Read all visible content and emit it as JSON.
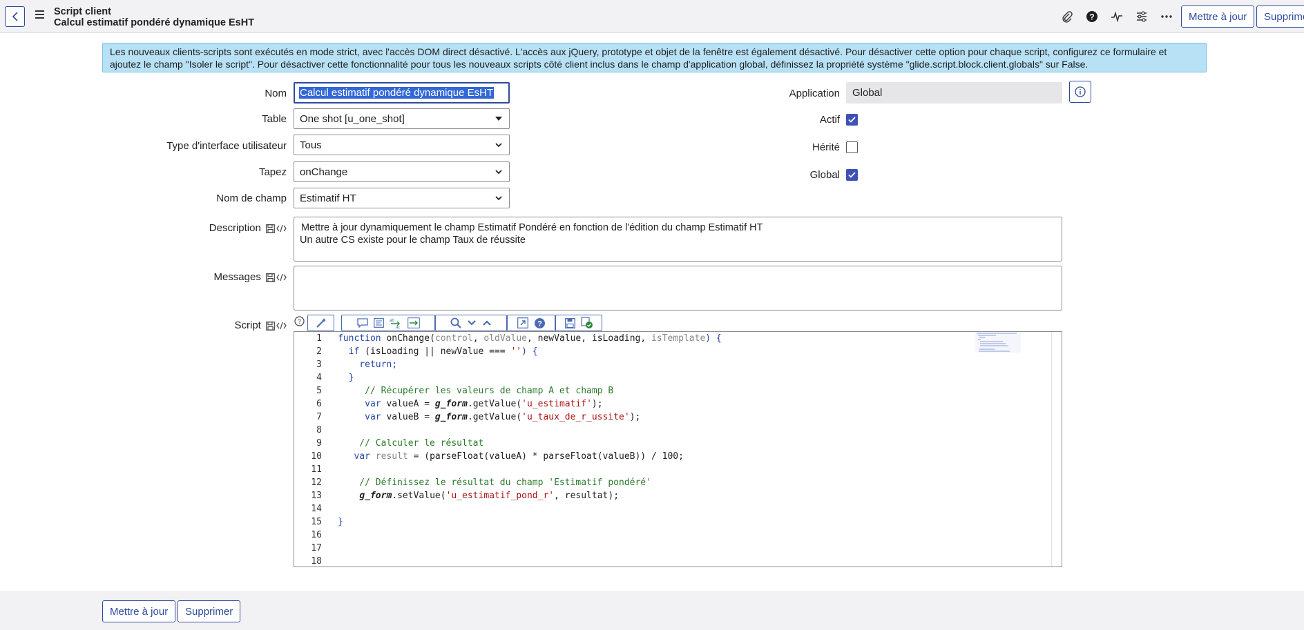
{
  "header": {
    "subtitle": "Script client",
    "title": "Calcul estimatif pondéré dynamique EsHT",
    "update_label": "Mettre à jour",
    "delete_label": "Supprime"
  },
  "alert": {
    "text": "Les nouveaux clients-scripts sont exécutés en mode strict, avec l'accès DOM direct désactivé. L'accès aux jQuery, prototype et objet de la fenêtre est également désactivé. Pour désactiver cette option pour chaque script, configurez ce formulaire et ajoutez le champ \"Isoler le script\". Pour désactiver cette fonctionnalité pour tous les nouveaux scripts côté client inclus dans le champ d'application global, définissez la propriété système \"glide.script.block.client.globals\" sur False."
  },
  "form": {
    "nom_label": "Nom",
    "nom_value": "Calcul estimatif pondéré dynamique EsHT",
    "table_label": "Table",
    "table_value": "One shot [u_one_shot]",
    "ui_type_label": "Type d'interface utilisateur",
    "ui_type_value": "Tous",
    "tapez_label": "Tapez",
    "tapez_value": "onChange",
    "field_name_label": "Nom de champ",
    "field_name_value": "Estimatif HT",
    "application_label": "Application",
    "application_value": "Global",
    "actif_label": "Actif",
    "herite_label": "Hérité",
    "global_label": "Global",
    "description_label": "Description",
    "description_line1": "Mettre à jour dynamiquement le champ Estimatif Pondéré en fonction de l'édition du champ Estimatif HT",
    "description_line2": "Un autre CS existe pour le champ Taux de réussite",
    "messages_label": "Messages",
    "script_label": "Script"
  },
  "checkboxes": {
    "actif": true,
    "herite": false,
    "global": true
  },
  "script": {
    "line_numbers": [
      "1",
      "2",
      "3",
      "4",
      "5",
      "6",
      "7",
      "8",
      "9",
      "10",
      "11",
      "12",
      "13",
      "14",
      "15",
      "16",
      "17",
      "18"
    ],
    "l1": {
      "a": "function ",
      "b": "onChange(",
      "c": "control",
      "d": ", ",
      "e": "oldValue",
      "f": ", newValue, isLoading, ",
      "g": "isTemplate",
      "h": ") {"
    },
    "l2": {
      "a": "  if ",
      "b": "(isLoading || newValue === ",
      "c": "''",
      "d": ") {"
    },
    "l3": "    return;",
    "l4": "  }",
    "l5": "     // Récupérer les valeurs de champ A et champ B",
    "l6": {
      "a": "     var ",
      "b": "valueA = ",
      "c": "g_form",
      "d": ".getValue(",
      "e": "'u_estimatif'",
      "f": ");"
    },
    "l7": {
      "a": "     var ",
      "b": "valueB = ",
      "c": "g_form",
      "d": ".getValue(",
      "e": "'u_taux_de_r_ussite'",
      "f": ");"
    },
    "l9": "    // Calculer le résultat",
    "l10": {
      "a": "   var ",
      "b": "result",
      "c": " = (parseFloat(valueA) * parseFloat(valueB)) / 100;"
    },
    "l12": "    // Définissez le résultat du champ 'Estimatif pondéré'",
    "l13": {
      "a": "    ",
      "b": "g_form",
      "c": ".setValue(",
      "d": "'u_estimatif_pond_r'",
      "e": ", resultat);"
    },
    "l15": "}"
  },
  "footer": {
    "update_label": "Mettre à jour",
    "delete_label": "Supprimer"
  },
  "colors": {
    "accent": "#2e4a9e",
    "checkbox": "#3f51b5",
    "alert_bg": "#b8e1f5",
    "header_bg": "#f2f2f4"
  }
}
